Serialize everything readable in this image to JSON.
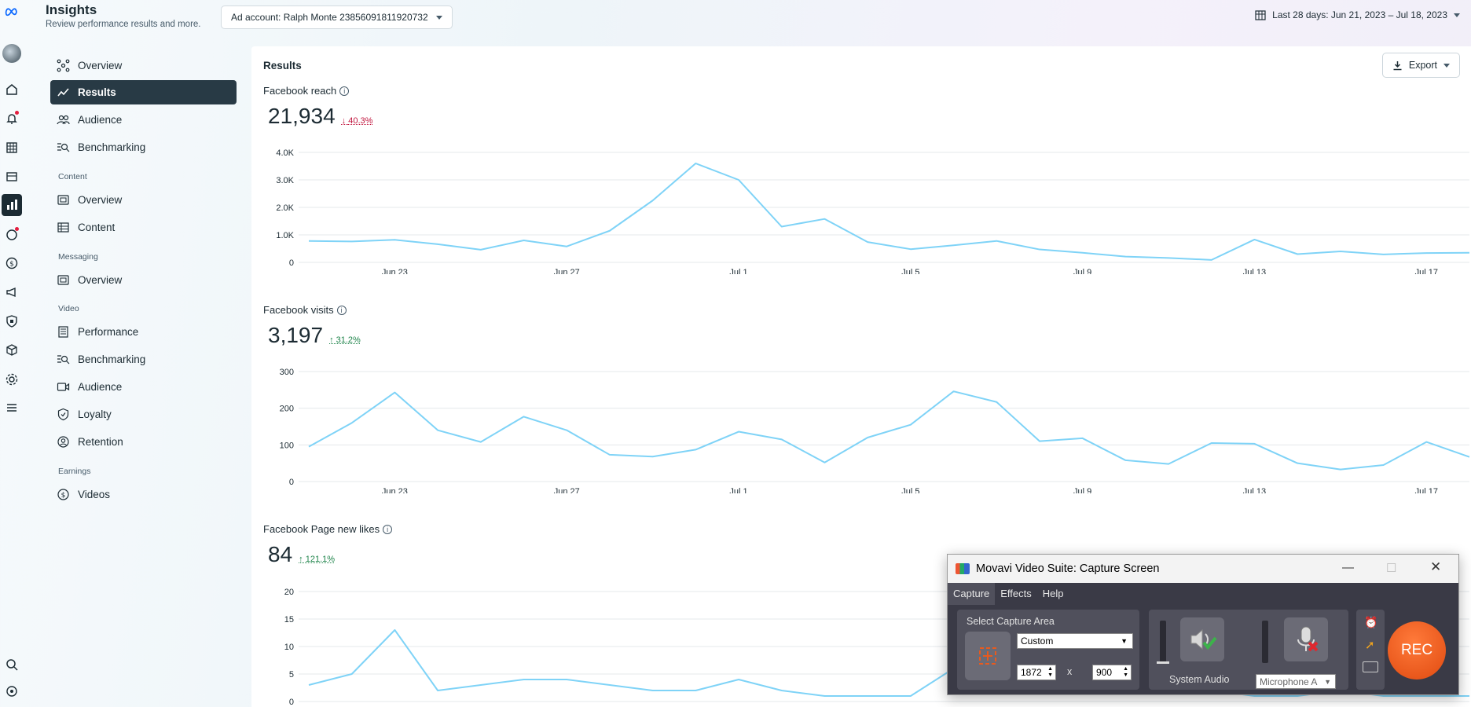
{
  "header": {
    "title": "Insights",
    "subtitle": "Review performance results and more.",
    "ad_account": "Ad account: Ralph Monte 23856091811920732",
    "date_range": "Last 28 days: Jun 21, 2023 – Jul 18, 2023"
  },
  "nav": {
    "items": [
      {
        "label": "Overview",
        "icon": "overview-icon"
      },
      {
        "label": "Results",
        "icon": "results-icon",
        "active": true
      },
      {
        "label": "Audience",
        "icon": "audience-icon"
      },
      {
        "label": "Benchmarking",
        "icon": "benchmarking-icon"
      }
    ],
    "content_section": "Content",
    "content_items": [
      {
        "label": "Overview"
      },
      {
        "label": "Content"
      }
    ],
    "messaging_section": "Messaging",
    "messaging_items": [
      {
        "label": "Overview"
      }
    ],
    "video_section": "Video",
    "video_items": [
      {
        "label": "Performance"
      },
      {
        "label": "Benchmarking"
      },
      {
        "label": "Audience"
      },
      {
        "label": "Loyalty"
      },
      {
        "label": "Retention"
      }
    ],
    "earnings_section": "Earnings",
    "earnings_items": [
      {
        "label": "Videos"
      }
    ]
  },
  "main": {
    "title": "Results",
    "export_label": "Export"
  },
  "x_ticks": [
    "Jun 23",
    "Jun 27",
    "Jul 1",
    "Jul 5",
    "Jul 9",
    "Jul 13",
    "Jul 17"
  ],
  "chart_data": [
    {
      "type": "line",
      "title": "Facebook reach",
      "total": "21,934",
      "change": "40.3%",
      "direction": "down",
      "ylim": [
        0,
        4000
      ],
      "yticks": [
        "0",
        "1.0K",
        "2.0K",
        "3.0K",
        "4.0K"
      ],
      "x": [
        "Jun 21",
        "Jun 22",
        "Jun 23",
        "Jun 24",
        "Jun 25",
        "Jun 26",
        "Jun 27",
        "Jun 28",
        "Jun 29",
        "Jun 30",
        "Jul 1",
        "Jul 2",
        "Jul 3",
        "Jul 4",
        "Jul 5",
        "Jul 6",
        "Jul 7",
        "Jul 8",
        "Jul 9",
        "Jul 10",
        "Jul 11",
        "Jul 12",
        "Jul 13",
        "Jul 14",
        "Jul 15",
        "Jul 16",
        "Jul 17",
        "Jul 18"
      ],
      "values": [
        780,
        760,
        820,
        660,
        460,
        800,
        580,
        1150,
        2250,
        3600,
        3000,
        1300,
        1580,
        740,
        480,
        620,
        780,
        470,
        350,
        210,
        160,
        90,
        830,
        300,
        400,
        290,
        340,
        350
      ],
      "color": "#7fd3f7"
    },
    {
      "type": "line",
      "title": "Facebook visits",
      "total": "3,197",
      "change": "31.2%",
      "direction": "up",
      "ylim": [
        0,
        300
      ],
      "yticks": [
        "0",
        "100",
        "200",
        "300"
      ],
      "x": [
        "Jun 21",
        "Jun 22",
        "Jun 23",
        "Jun 24",
        "Jun 25",
        "Jun 26",
        "Jun 27",
        "Jun 28",
        "Jun 29",
        "Jun 30",
        "Jul 1",
        "Jul 2",
        "Jul 3",
        "Jul 4",
        "Jul 5",
        "Jul 6",
        "Jul 7",
        "Jul 8",
        "Jul 9",
        "Jul 10",
        "Jul 11",
        "Jul 12",
        "Jul 13",
        "Jul 14",
        "Jul 15",
        "Jul 16",
        "Jul 17",
        "Jul 18"
      ],
      "values": [
        95,
        160,
        243,
        140,
        108,
        177,
        140,
        73,
        68,
        87,
        136,
        115,
        52,
        120,
        155,
        246,
        217,
        110,
        118,
        58,
        48,
        105,
        103,
        50,
        33,
        45,
        108,
        67
      ],
      "color": "#7fd3f7"
    },
    {
      "type": "line",
      "title": "Facebook Page new likes",
      "total": "84",
      "change": "121.1%",
      "direction": "up",
      "ylim": [
        0,
        20
      ],
      "yticks": [
        "0",
        "5",
        "10",
        "15",
        "20"
      ],
      "x": [
        "Jun 21",
        "Jun 22",
        "Jun 23",
        "Jun 24",
        "Jun 25",
        "Jun 26",
        "Jun 27",
        "Jun 28",
        "Jun 29",
        "Jun 30",
        "Jul 1",
        "Jul 2",
        "Jul 3",
        "Jul 4",
        "Jul 5",
        "Jul 6",
        "Jul 7",
        "Jul 8",
        "Jul 9",
        "Jul 10",
        "Jul 11",
        "Jul 12",
        "Jul 13",
        "Jul 14",
        "Jul 15",
        "Jul 16",
        "Jul 17",
        "Jul 18"
      ],
      "values": [
        3,
        5,
        13,
        2,
        3,
        4,
        4,
        3,
        2,
        2,
        4,
        2,
        1,
        1,
        1,
        6,
        8,
        4,
        3,
        2,
        3,
        2,
        1,
        1,
        2,
        1,
        1,
        1
      ],
      "color": "#7fd3f7"
    }
  ],
  "movavi": {
    "title": "Movavi Video Suite: Capture Screen",
    "menu": [
      "Capture",
      "Effects",
      "Help"
    ],
    "select_area_label": "Select Capture Area",
    "area_preset": "Custom",
    "width": "1872",
    "height": "900",
    "times": "x",
    "system_audio_label": "System Audio",
    "microphone": "Microphone A",
    "rec_label": "REC"
  }
}
